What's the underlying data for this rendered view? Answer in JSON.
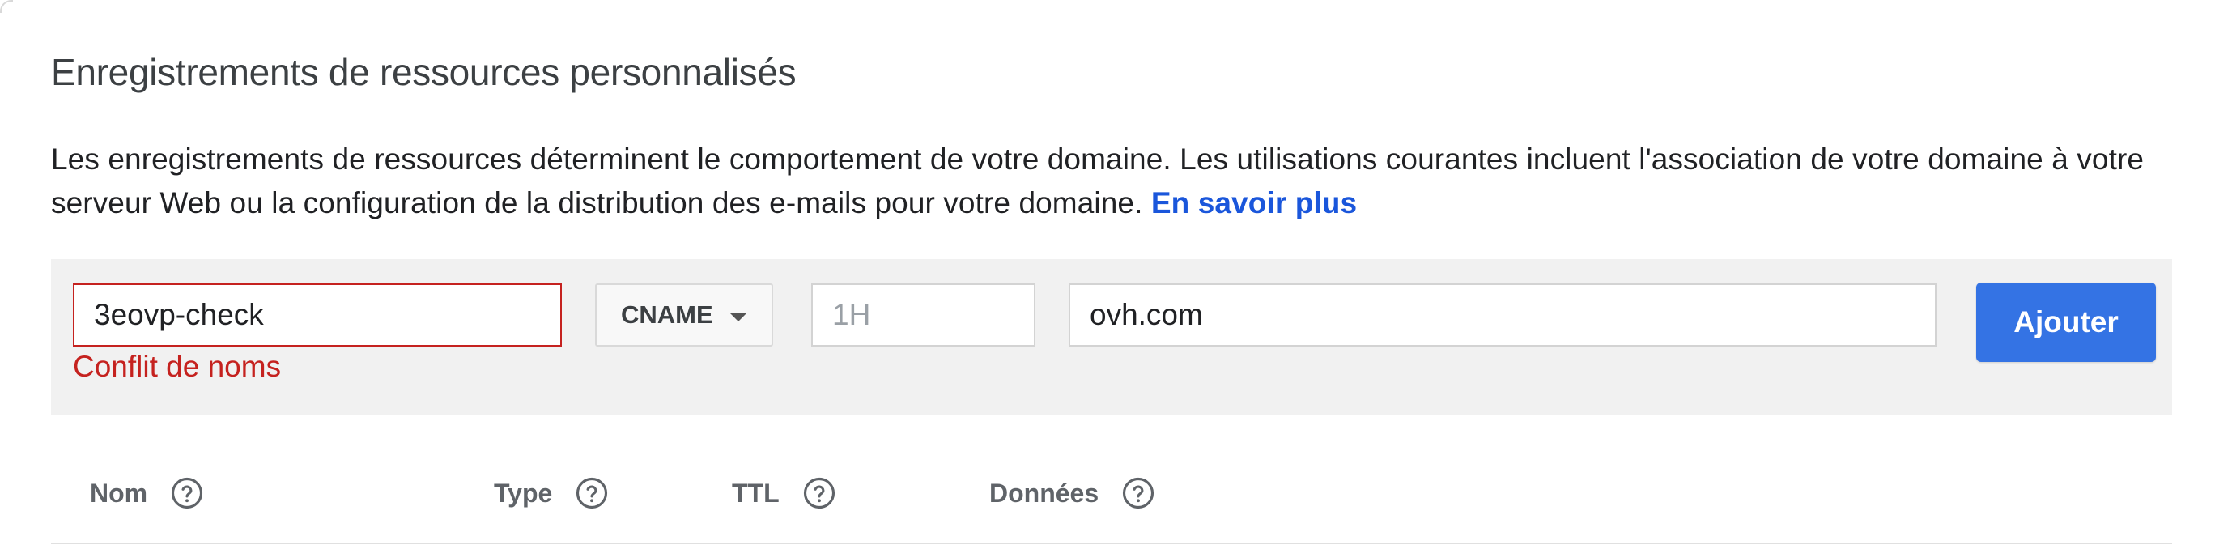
{
  "section": {
    "title": "Enregistrements de ressources personnalisés",
    "description": "Les enregistrements de ressources déterminent le comportement de votre domaine. Les utilisations courantes incluent l'association de votre domaine à votre serveur Web ou la configuration de la distribution des e-mails pour votre domaine. ",
    "learn_more": "En savoir plus"
  },
  "form": {
    "name_value": "3eovp-check",
    "name_error": "Conflit de noms",
    "type_value": "CNAME",
    "ttl_placeholder": "1H",
    "data_value": "ovh.com",
    "add_label": "Ajouter"
  },
  "table": {
    "columns": [
      "Nom",
      "Type",
      "TTL",
      "Données"
    ]
  },
  "colors": {
    "accent": "#3473e4",
    "link": "#1a56db",
    "error": "#c5221f",
    "panel_bg": "#f1f1f1"
  },
  "icons": {
    "help": "help-circle-icon",
    "dropdown": "chevron-down-icon"
  }
}
